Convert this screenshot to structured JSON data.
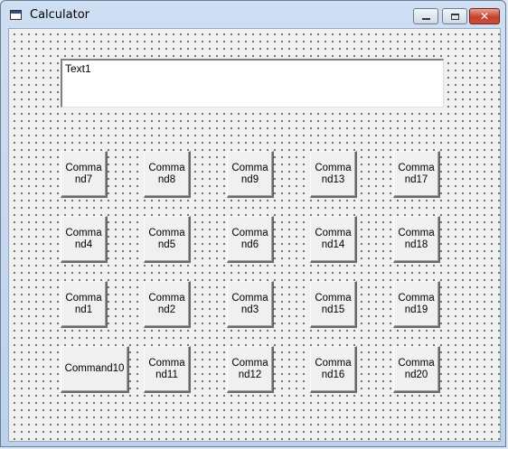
{
  "window": {
    "title": "Calculator",
    "controls": {
      "minimize": "",
      "maximize": "",
      "close": "✕"
    }
  },
  "textbox": {
    "text": "Text1"
  },
  "buttons": {
    "row1": [
      "Command7",
      "Command8",
      "Command9",
      "Command13",
      "Command17"
    ],
    "row2": [
      "Command4",
      "Command5",
      "Command6",
      "Command14",
      "Command18"
    ],
    "row3": [
      "Command1",
      "Command2",
      "Command3",
      "Command15",
      "Command19"
    ],
    "row4": [
      "Command10",
      "Command11",
      "Command12",
      "Command16",
      "Command20"
    ]
  }
}
